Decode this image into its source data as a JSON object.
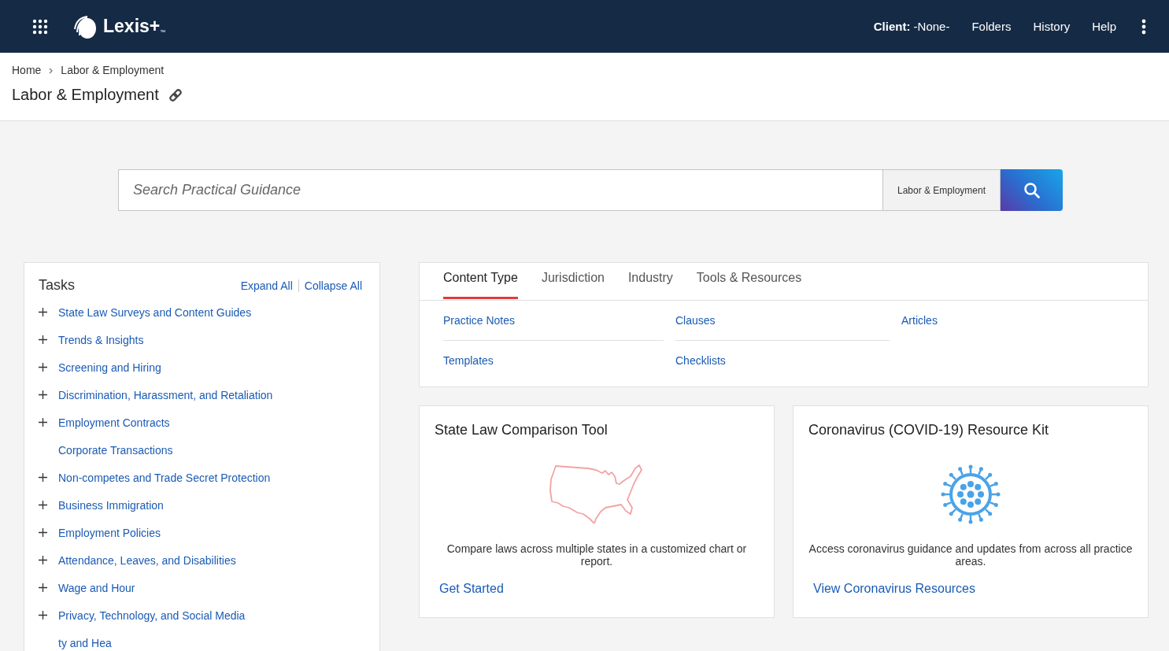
{
  "header": {
    "client_label": "Client:",
    "client_value": "-None-",
    "nav": [
      "Folders",
      "History",
      "Help"
    ]
  },
  "logo": {
    "text": "Lexis+",
    "mark": "™"
  },
  "breadcrumb": [
    "Home",
    "Labor & Employment"
  ],
  "page_title": "Labor & Employment",
  "search": {
    "placeholder": "Search Practical Guidance",
    "scope": "Labor & Employment"
  },
  "tasks": {
    "title": "Tasks",
    "actions": [
      "Expand All",
      "Collapse All"
    ],
    "items": [
      {
        "label": "State Law Surveys and Content Guides",
        "expandable": true
      },
      {
        "label": "Trends & Insights",
        "expandable": true
      },
      {
        "label": "Screening and Hiring",
        "expandable": true
      },
      {
        "label": "Discrimination, Harassment, and Retaliation",
        "expandable": true
      },
      {
        "label": "Employment Contracts",
        "expandable": true
      },
      {
        "label": "Corporate Transactions",
        "expandable": false
      },
      {
        "label": "Non-competes and Trade Secret Protection",
        "expandable": true
      },
      {
        "label": "Business Immigration",
        "expandable": true
      },
      {
        "label": "Employment Policies",
        "expandable": true
      },
      {
        "label": "Attendance, Leaves, and Disabilities",
        "expandable": true
      },
      {
        "label": "Wage and Hour",
        "expandable": true
      },
      {
        "label": "Privacy, Technology, and Social Media",
        "expandable": true
      },
      {
        "label": "ty and Hea",
        "expandable": false
      }
    ]
  },
  "content_tabs": [
    {
      "label": "Content Type",
      "selected": true
    },
    {
      "label": "Jurisdiction",
      "selected": false
    },
    {
      "label": "Industry",
      "selected": false
    },
    {
      "label": "Tools & Resources",
      "selected": false
    }
  ],
  "content_links": [
    "Practice Notes",
    "Clauses",
    "Articles",
    "Templates",
    "Checklists"
  ],
  "cards": [
    {
      "title": "State Law Comparison Tool",
      "kind": "map",
      "text": "Compare laws across multiple states in a customized chart or report.",
      "link": "Get Started"
    },
    {
      "title": "Coronavirus (COVID-19) Resource Kit",
      "kind": "virus",
      "text": "Access coronavirus guidance and updates from across all practice areas.",
      "link": "View Coronavirus Resources"
    }
  ]
}
